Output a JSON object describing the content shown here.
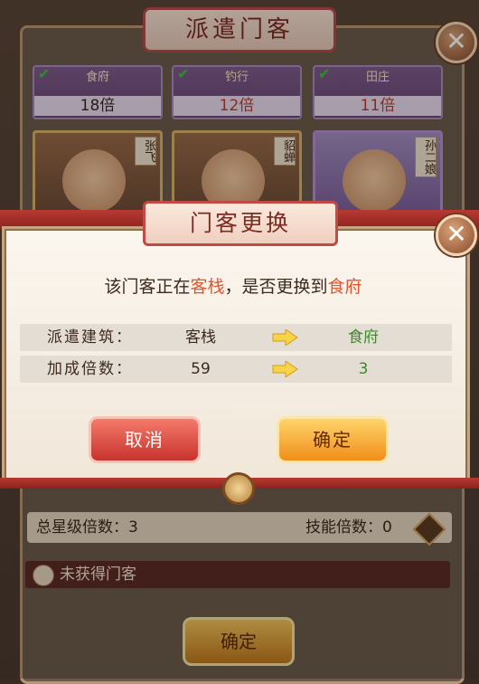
{
  "background": {
    "title": "派遣门客",
    "top_cards": [
      {
        "name": "食府",
        "multiplier": "18倍",
        "mult_color": "#3a2a1e"
      },
      {
        "name": "钓行",
        "multiplier": "12倍",
        "mult_color": "#c0392b"
      },
      {
        "name": "田庄",
        "multiplier": "11倍",
        "mult_color": "#c0392b"
      }
    ],
    "heroes": [
      {
        "name": "张飞"
      },
      {
        "name": "貂蝉"
      },
      {
        "name": "孙二娘"
      }
    ],
    "total_star_label": "总星级倍数：3",
    "skill_label": "技能倍数：0",
    "not_obtained": "未获得门客",
    "confirm": "确定"
  },
  "dialog": {
    "title": "门客更换",
    "message_prefix": "该门客正在",
    "message_current": "客栈",
    "message_mid": "，是否更换到",
    "message_target": "食府",
    "rows": [
      {
        "label": "派遣建筑：",
        "from": "客栈",
        "to": "食府"
      },
      {
        "label": "加成倍数：",
        "from": "59",
        "to": "3"
      }
    ],
    "cancel": "取消",
    "confirm": "确定"
  },
  "colors": {
    "highlight": "#e0572e",
    "target_green": "#3d8a2a",
    "cancel_red": "#c8332d",
    "confirm_orange": "#f08e1a"
  }
}
